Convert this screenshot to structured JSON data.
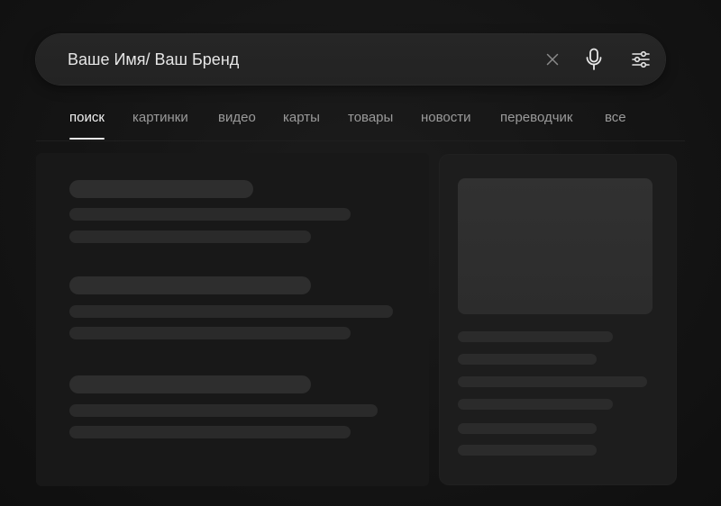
{
  "search": {
    "value": "Ваше Имя/ Ваш Бренд",
    "clear_icon": "close-icon",
    "mic_icon": "microphone-icon",
    "filter_icon": "sliders-icon"
  },
  "tabs": [
    {
      "label": "поиск",
      "active": true
    },
    {
      "label": "картинки",
      "active": false
    },
    {
      "label": "видео",
      "active": false
    },
    {
      "label": "карты",
      "active": false
    },
    {
      "label": "товары",
      "active": false
    },
    {
      "label": "новости",
      "active": false
    },
    {
      "label": "переводчик",
      "active": false
    },
    {
      "label": "все",
      "active": false
    }
  ],
  "colors": {
    "background": "#151515",
    "search_bar": "#252525",
    "active_tab": "#f2f2f2",
    "inactive_tab": "#9a9a9a",
    "placeholder_block": "#2a2a2a"
  }
}
